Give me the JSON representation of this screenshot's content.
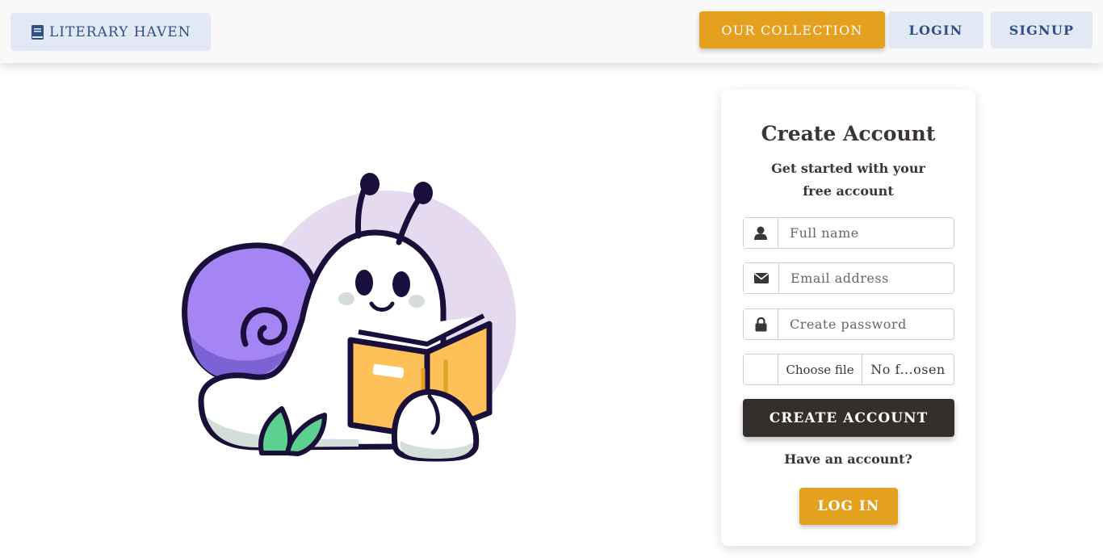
{
  "navbar": {
    "brand_label": "LITERARY HAVEN",
    "brand_icon": "book-icon",
    "collection_label": "OUR COLLECTION",
    "login_label": "LOGIN",
    "signup_label": "SIGNUP"
  },
  "illustration": {
    "subject": "snail-reading-book",
    "colors": {
      "background_circle": "#e6daf1",
      "shell": "#a585f4",
      "shell_shade": "#7c62d4",
      "body": "#ffffff",
      "outline": "#1a0f3a",
      "book": "#fec15a",
      "book_shade": "#e3a11f",
      "leaf": "#5bd08f",
      "cheek": "#d3ded9"
    }
  },
  "signup_card": {
    "title": "Create Account",
    "subtitle": "Get started with your free account",
    "fields": {
      "full_name": {
        "placeholder": "Full name",
        "icon": "user-icon"
      },
      "email": {
        "placeholder": "Email address",
        "icon": "envelope-icon"
      },
      "password": {
        "placeholder": "Create password",
        "icon": "lock-icon"
      },
      "file": {
        "choose_label": "Choose file",
        "file_name": "No f...osen"
      }
    },
    "create_button_label": "CREATE ACCOUNT",
    "have_account_text": "Have an account?",
    "login_button_label": "LOG IN"
  },
  "colors": {
    "accent_gold": "#e3a11f",
    "nav_pill_bg": "#e2e9f4",
    "nav_text_blue": "#2f4f86",
    "dark_button": "#342e2c"
  }
}
